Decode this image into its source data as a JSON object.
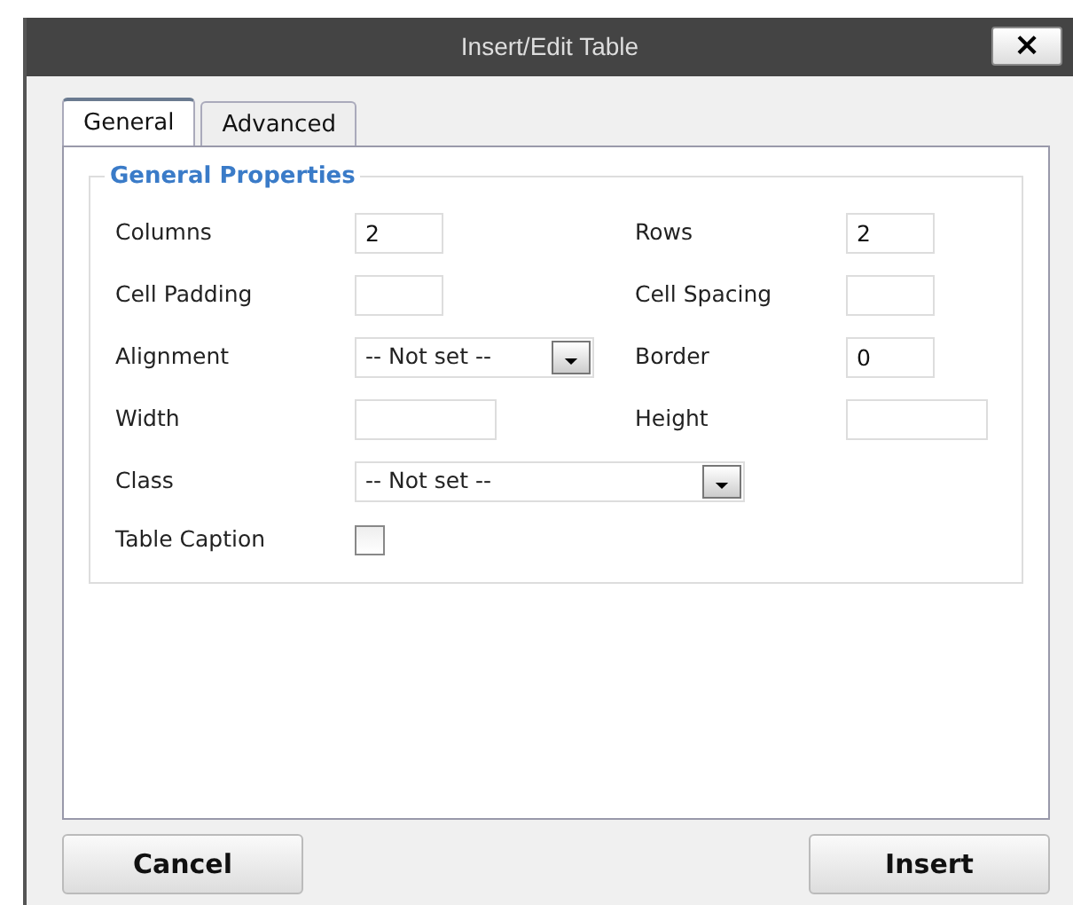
{
  "window": {
    "title": "Insert/Edit Table",
    "close": "×"
  },
  "tabs": [
    {
      "label": "General",
      "selected": true
    },
    {
      "label": "Advanced",
      "selected": false
    }
  ],
  "group": {
    "legend": "General Properties",
    "rows": [
      [
        {
          "label": "Columns",
          "kind": "text",
          "value": "2"
        },
        {
          "label": "Rows",
          "kind": "text",
          "value": "2"
        }
      ],
      [
        {
          "label": "Cell Padding",
          "kind": "text"
        },
        {
          "label": "Cell Spacing",
          "kind": "text"
        }
      ],
      [
        {
          "label": "Alignment",
          "kind": "select",
          "value": "-- Not set --"
        },
        {
          "label": "Border",
          "kind": "text",
          "value": "0"
        }
      ],
      [
        {
          "label": "Width",
          "kind": "text"
        },
        {
          "label": "Height",
          "kind": "text"
        }
      ],
      [
        {
          "label": "Class",
          "kind": "select",
          "value": "-- Not set --"
        }
      ],
      [
        {
          "label": "Table Caption",
          "kind": "checkbox",
          "checked": false
        }
      ]
    ]
  },
  "buttons": [
    "Cancel",
    "Insert"
  ]
}
